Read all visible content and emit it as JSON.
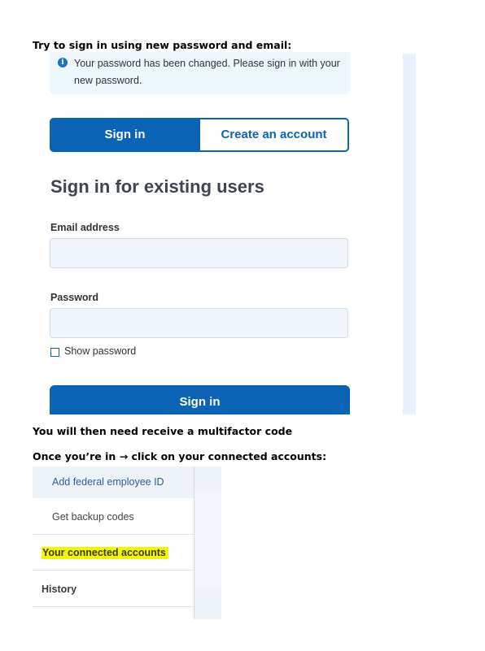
{
  "instructions": {
    "step1": "Try to sign in using new password and email:",
    "step2": "You will then need receive a multifactor code",
    "step3_prefix": "Once you’re in",
    "step3_arrow": "→",
    "step3_suffix": "click on your connected accounts:"
  },
  "signin_screen": {
    "alert": {
      "icon": "info-icon",
      "message": "Your password has been changed. Please sign in with your new password."
    },
    "tabs": [
      {
        "label": "Sign in",
        "active": true
      },
      {
        "label": "Create an account",
        "active": false
      }
    ],
    "heading": "Sign in for existing users",
    "email": {
      "label": "Email address",
      "value": ""
    },
    "password": {
      "label": "Password",
      "value": ""
    },
    "show_password": {
      "label": "Show password",
      "checked": false
    },
    "submit_label": "Sign in",
    "colors": {
      "primary": "#0b63b5",
      "alert_bg": "#eef8fc",
      "field_bg": "#f0f5fb"
    }
  },
  "account_menu": {
    "items": [
      {
        "label": "Add federal employee ID"
      },
      {
        "label": "Get backup codes"
      },
      {
        "label": "Your connected accounts",
        "highlighted": true
      },
      {
        "label": "History"
      }
    ],
    "highlight_color": "#f5f500"
  }
}
